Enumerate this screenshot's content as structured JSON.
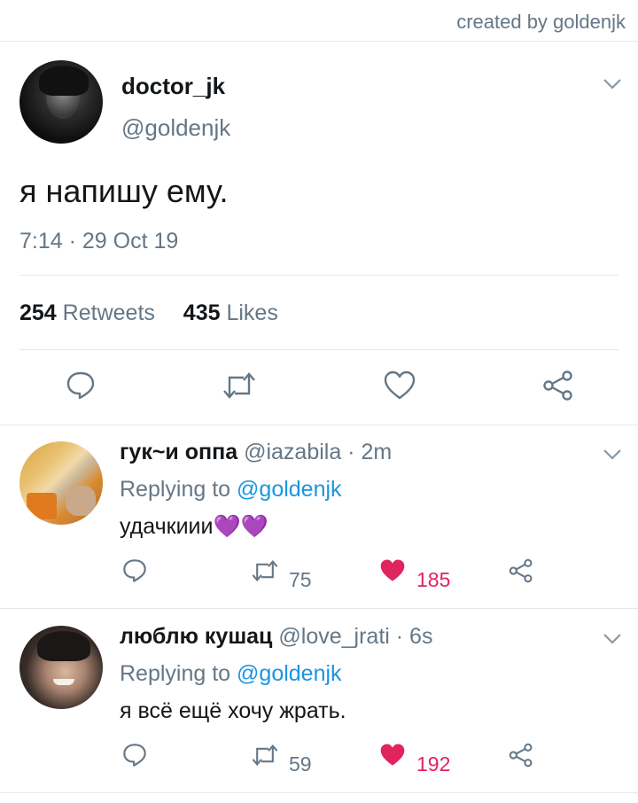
{
  "credit": "created by goldenjk",
  "tweet": {
    "name": "doctor_jk",
    "handle": "@goldenjk",
    "text": "я напишу ему.",
    "time": "7:14 · 29 Oct 19",
    "retweets_count": "254",
    "retweets_label": "Retweets",
    "likes_count": "435",
    "likes_label": "Likes"
  },
  "replies": [
    {
      "name": "гук~и оппа",
      "handle": "@iazabila · 2m",
      "replying_prefix": "Replying to",
      "replying_to": "@goldenjk",
      "text": "удачкиии💜💜",
      "retweets": "75",
      "likes": "185"
    },
    {
      "name": "люблю кушац",
      "handle": "@love_jrati · 6s",
      "replying_prefix": "Replying to",
      "replying_to": "@goldenjk",
      "text": "я всё ещё хочу жрать.",
      "retweets": "59",
      "likes": "192"
    }
  ],
  "icons": [
    "reply-icon",
    "retweet-icon",
    "like-icon",
    "share-icon",
    "chevron-down-icon"
  ],
  "colors": {
    "muted": "#657786",
    "link": "#1b95e0",
    "like": "#e0245e",
    "divider": "#e1e8ed"
  }
}
